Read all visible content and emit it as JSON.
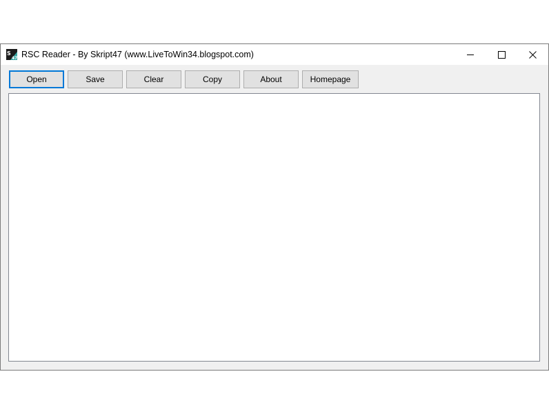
{
  "window": {
    "title": "RSC Reader - By Skript47 (www.LiveToWin34.blogspot.com)",
    "icon": "app-icon-s47",
    "caption_icons": [
      "minimize-icon",
      "maximize-icon",
      "close-icon"
    ]
  },
  "toolbar": {
    "open_label": "Open",
    "save_label": "Save",
    "clear_label": "Clear",
    "copy_label": "Copy",
    "about_label": "About",
    "homepage_label": "Homepage"
  },
  "editor": {
    "content": ""
  },
  "colors": {
    "accent": "#0078d7",
    "icon_teal": "#3aa7a3",
    "icon_dark": "#1b1b1b"
  }
}
